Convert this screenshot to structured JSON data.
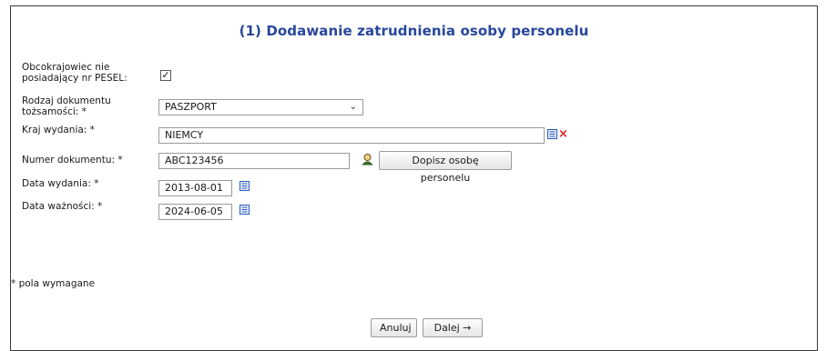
{
  "form": {
    "title": "(1) Dodawanie zatrudnienia osoby personelu",
    "foreigner_label": "Obcokrajowiec nie posiadający nr PESEL:",
    "foreigner_checked": true,
    "doc_type_label": "Rodzaj dokumentu tożsamości: *",
    "doc_type_value": "PASZPORT",
    "country_label": "Kraj wydania: *",
    "country_value": "NIEMCY",
    "doc_number_label": "Numer dokumentu: *",
    "doc_number_value": "ABC123456",
    "add_person_button": "Dopisz osobę personelu",
    "issue_date_label": "Data wydania: *",
    "issue_date_value": "2013-08-01",
    "expiry_date_label": "Data ważności: *",
    "expiry_date_value": "2024-06-05",
    "required_note": "* pola wymagane",
    "cancel_button": "Anuluj",
    "next_button": "Dalej →"
  },
  "icons": {
    "list_icon": "list-icon",
    "clear_icon": "clear-x-icon",
    "person_search_icon": "person-search-icon",
    "calendar_icon": "calendar-icon"
  },
  "colors": {
    "title": "#27479a",
    "clear_x": "#d62020",
    "icon_blue": "#2a5bb8"
  }
}
